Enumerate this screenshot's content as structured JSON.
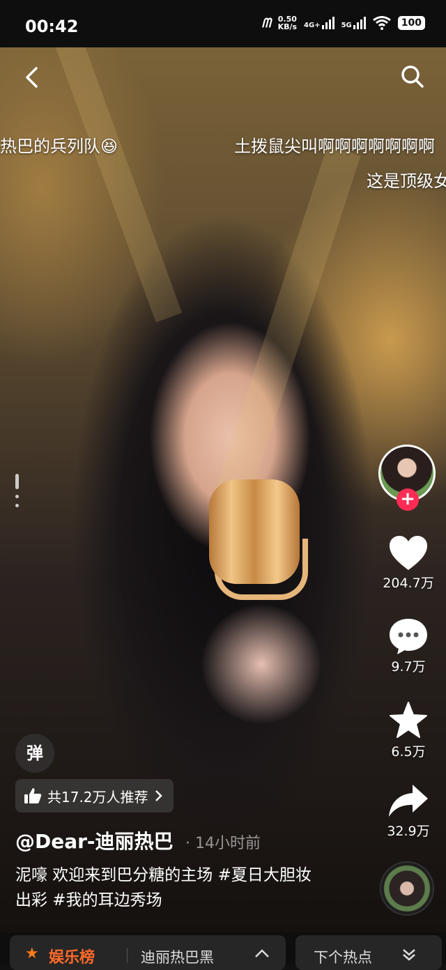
{
  "status_bar": {
    "time": "00:42",
    "net_speed_value": "0.50",
    "net_speed_unit": "KB/s",
    "signal1": "4G+",
    "signal2": "5G",
    "battery": "100"
  },
  "danmaku": [
    "热巴的兵列队😆",
    "土拨鼠尖叫啊啊啊啊啊啊啊",
    "这是顶级女"
  ],
  "rail": {
    "likes": "204.7万",
    "comments": "9.7万",
    "favorites": "6.5万",
    "shares": "32.9万"
  },
  "danmu_button": "弹",
  "recommend_text": "共17.2万人推荐",
  "author": "@Dear-迪丽热巴",
  "post_time": "· 14小时前",
  "description": "泥嚎 欢迎来到巴分糖的主场 #夏日大胆妆出彩 #我的耳边秀场",
  "bottom": {
    "rank_label": "娱乐榜",
    "hot_topic": "迪丽热巴黑",
    "next_label": "下个热点"
  },
  "colors": {
    "accent_red": "#fe2c55",
    "rank_orange": "#ff6a2a"
  }
}
